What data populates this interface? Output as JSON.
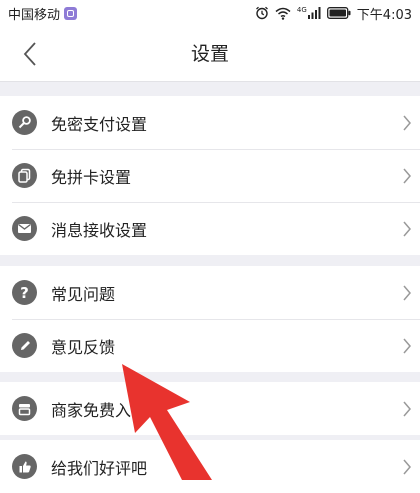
{
  "status_bar": {
    "carrier": "中国移动",
    "time": "下午4:03",
    "network": "4G"
  },
  "nav": {
    "title": "设置"
  },
  "groups": [
    {
      "items": [
        {
          "label": "免密支付设置",
          "icon": "key-icon"
        },
        {
          "label": "免拼卡设置",
          "icon": "card-icon"
        },
        {
          "label": "消息接收设置",
          "icon": "mail-icon"
        }
      ]
    },
    {
      "items": [
        {
          "label": "常见问题",
          "icon": "question-icon"
        },
        {
          "label": "意见反馈",
          "icon": "pencil-icon"
        }
      ]
    },
    {
      "items": [
        {
          "label": "商家免费入",
          "icon": "store-icon"
        }
      ]
    },
    {
      "items": [
        {
          "label": "给我们好评吧",
          "icon": "thumbs-up-icon"
        }
      ]
    }
  ],
  "colors": {
    "background": "#efeff4",
    "icon_bg": "#666666",
    "annotation_arrow": "#e8332e"
  }
}
